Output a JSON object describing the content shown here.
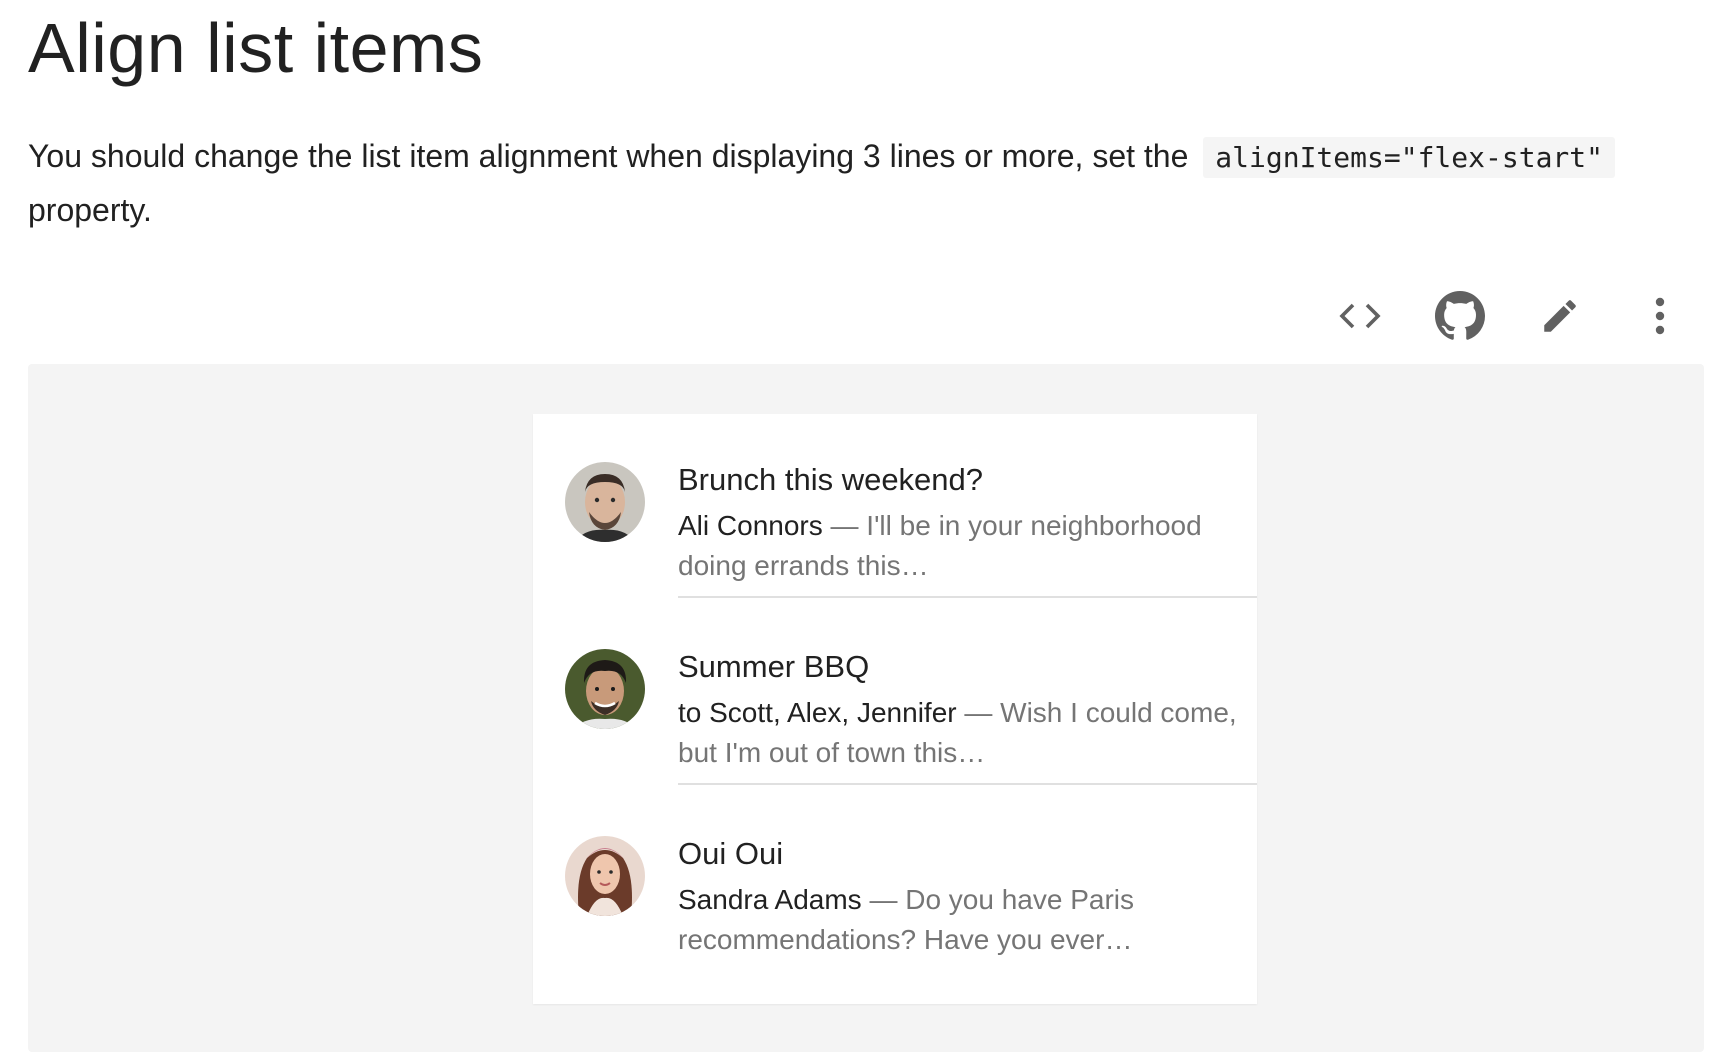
{
  "page": {
    "title": "Align list items",
    "description_text": "You should change the list item alignment when displaying 3 lines or more, set the",
    "description_code": "alignItems=\"flex-start\"",
    "description_tail": "property."
  },
  "toolbar": {
    "buttons": [
      {
        "name": "view-source",
        "icon": "code-icon"
      },
      {
        "name": "github",
        "icon": "github-icon"
      },
      {
        "name": "edit",
        "icon": "pencil-icon"
      },
      {
        "name": "more",
        "icon": "more-vert-icon"
      }
    ]
  },
  "list": {
    "items": [
      {
        "primary": "Brunch this weekend?",
        "sender": "Ali Connors",
        "separator": " — ",
        "preview": "I'll be in your neighborhood doing errands this…"
      },
      {
        "primary": "Summer BBQ",
        "sender": "to Scott, Alex, Jennifer",
        "separator": " — ",
        "preview": "Wish I could come, but I'm out of town this…"
      },
      {
        "primary": "Oui Oui",
        "sender": "Sandra Adams",
        "separator": " — ",
        "preview": "Do you have Paris recommendations? Have you ever…"
      }
    ]
  },
  "colors": {
    "text_primary": "#212121",
    "text_secondary": "#757575",
    "demo_background": "#f4f4f4",
    "divider": "#e0e0e0",
    "icon": "#616161"
  }
}
